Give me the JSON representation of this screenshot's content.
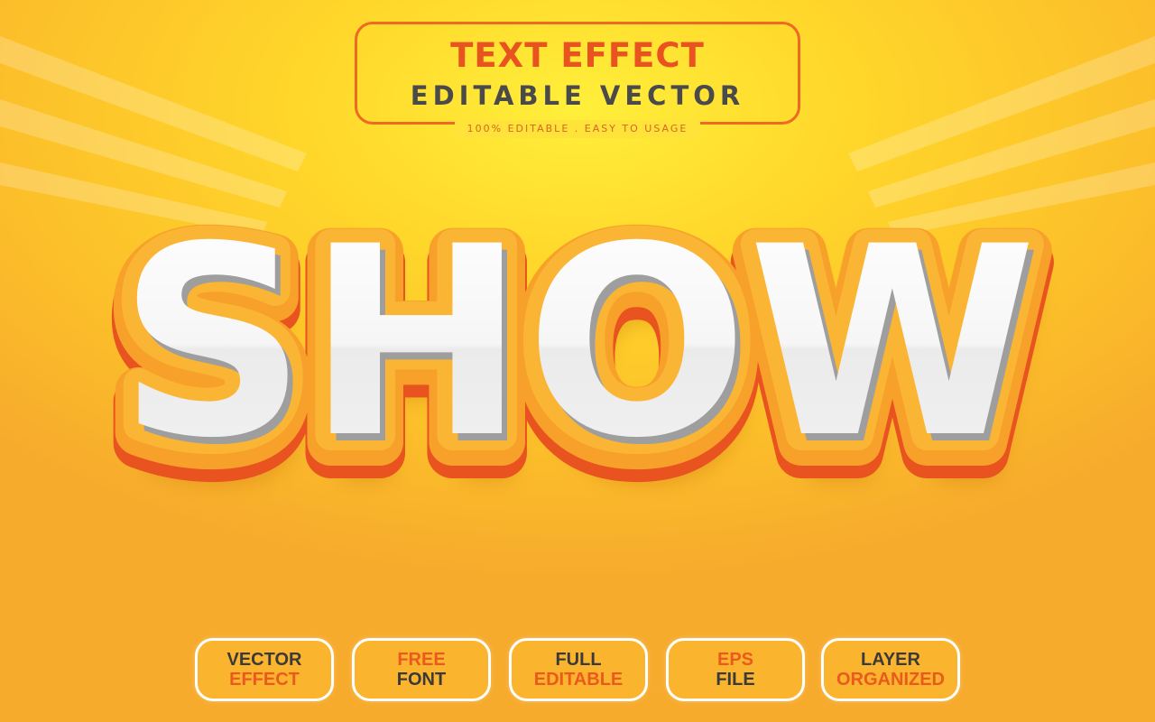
{
  "header": {
    "title": "TEXT EFFECT",
    "subtitle": "EDITABLE VECTOR",
    "tagline": "100% EDITABLE . EASY TO USAGE"
  },
  "main_text": "SHOW",
  "features": [
    {
      "line1": "VECTOR",
      "line2": "EFFECT"
    },
    {
      "line1": "FREE",
      "line2": "FONT"
    },
    {
      "line1": "FULL",
      "line2": "EDITABLE"
    },
    {
      "line1": "EPS",
      "line2": "FILE"
    },
    {
      "line1": "LAYER",
      "line2": "ORGANIZED"
    }
  ],
  "colors": {
    "accent_orange": "#ea5a1f",
    "dark_text": "#3a3a3a",
    "background_yellow": "#ffd62a",
    "outline_orange": "#f39a1e",
    "face_white": "#f4f4f4"
  }
}
